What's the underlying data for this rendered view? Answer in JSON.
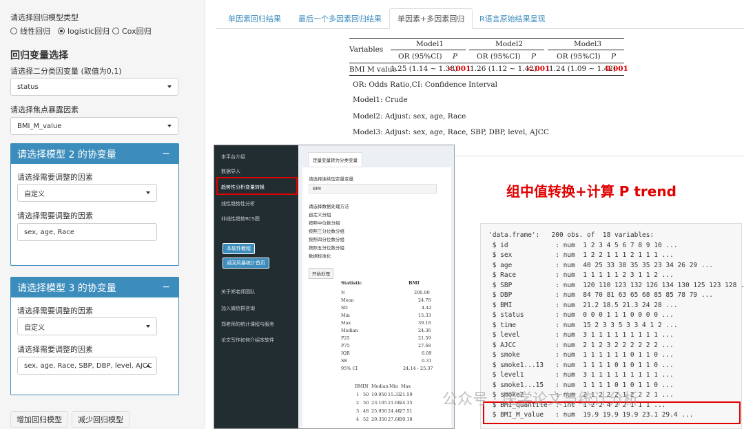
{
  "sidebar": {
    "model_type_label": "请选择回归模型类型",
    "radios": [
      "线性回归",
      "logistic回归",
      "Cox回归"
    ],
    "section_title": "回归变量选择",
    "binary_var_label": "请选择二分类因变量 (取值为0,1)",
    "binary_var_value": "status",
    "exposure_label": "请选择焦点暴露因素",
    "exposure_value": "BMI_M_value",
    "box2_title": "请选择模型 2 的协变量",
    "box2_factor_label1": "请选择需要调整的因素",
    "box2_factor_value1": "自定义",
    "box2_factor_label2": "请选择需要调整的因素",
    "box2_factor_value2": "sex, age, Race",
    "box3_title": "请选择模型 3 的协变量",
    "box3_factor_label1": "请选择需要调整的因素",
    "box3_factor_value1": "自定义",
    "box3_factor_label2": "请选择需要调整的因素",
    "box3_factor_value2": "sex, age, Race, SBP, DBP, level, AJCC",
    "minus": "−",
    "add_button": "增加回归模型",
    "remove_button": "减少回归模型"
  },
  "tabs": [
    "单因素回归结果",
    "最后一个多因素回归结果",
    "单因素+多因素回归",
    "R语言原始结果呈现"
  ],
  "table": {
    "variables": "Variables",
    "models": [
      "Model1",
      "Model2",
      "Model3"
    ],
    "or": "OR (95%CI)",
    "p": "P",
    "row_label": "BMI M value",
    "row": [
      [
        "1.25 (1.14 ~ 1.38)",
        "<.001"
      ],
      [
        "1.26 (1.12 ~ 1.42)",
        "<.001"
      ],
      [
        "1.24 (1.09 ~ 1.42)",
        "0.001"
      ]
    ]
  },
  "notes": [
    "OR: Odds Ratio,CI: Confidence Interval",
    "Model1: Crude",
    "Model2: Adjust: sex, age, Race",
    "Model3: Adjust: sex, age, Race, SBP, DBP, level, AJCC"
  ],
  "embed": {
    "menu": [
      "本平台介绍",
      "数据导入",
      "趋势性分析变量转换",
      "线性趋势性分析",
      "非线性趋势RCS图"
    ],
    "btn1": "本软件教程",
    "btn2": "返回风暴统计首页",
    "links": [
      "关于郑老师团队",
      "加入微信群咨询",
      "郑老师的统计课程与服务",
      "论文写作如何介绍本软件"
    ],
    "tab": "定量变量转为分类变量",
    "var_label": "请选择连续型定量变量",
    "var_value": "BMI",
    "method_label": "请选择数据处理方法",
    "methods": [
      "自定义分组",
      "按照中位数分组",
      "按照三分位数分组",
      "按照四分位数分组",
      "按照五分位数分组",
      "数据标准化"
    ],
    "start": "开始处理",
    "stat_head": [
      "Statistic",
      "BMI"
    ],
    "stats": [
      [
        "N",
        "200.00"
      ],
      [
        "Mean",
        "24.76"
      ],
      [
        "SD",
        "4.42"
      ],
      [
        "Min",
        "15.33"
      ],
      [
        "Max",
        "39.18"
      ],
      [
        "Median",
        "24.36"
      ],
      [
        "P25",
        "21.59"
      ],
      [
        "P75",
        "27.68"
      ],
      [
        "IQR",
        "6.09"
      ],
      [
        "SE",
        "0.31"
      ],
      [
        "95% CI",
        "24.14 - 25.37"
      ]
    ],
    "q_head": [
      "BMI",
      "N",
      "Median",
      "Min",
      "Max"
    ],
    "q_rows": [
      [
        "1",
        "50",
        "19.950",
        "15.33",
        "21.59"
      ],
      [
        "2",
        "50",
        "23.105",
        "21.60",
        "24.35"
      ],
      [
        "3",
        "48",
        "25.950",
        "24.40",
        "27.51"
      ],
      [
        "4",
        "52",
        "29.350",
        "27.68",
        "39.18"
      ]
    ]
  },
  "trend_title": "组中值转换+计算 P trend",
  "console": [
    "'data.frame':   200 obs. of  18 variables:",
    " $ id            : num  1 2 3 4 5 6 7 8 9 10 ...",
    " $ sex           : num  1 2 2 1 1 1 2 1 1 1 ...",
    " $ age           : num  40 25 33 38 35 35 23 34 26 29 ...",
    " $ Race          : num  1 1 1 1 1 2 3 1 1 2 ...",
    " $ SBP           : num  120 110 123 132 126 134 130 125 123 128 ...",
    " $ DBP           : num  84 70 81 63 65 68 85 85 78 79 ...",
    " $ BMI           : num  21.2 18.5 21.3 24 28 ...",
    " $ status        : num  0 0 0 1 1 1 0 0 0 0 ...",
    " $ time          : num  15 2 3 3 5 3 3 4 1 2 ...",
    " $ level         : num  3 1 1 1 1 1 1 1 1 1 ...",
    " $ AJCC          : num  2 1 2 3 2 2 2 2 2 2 ...",
    " $ smoke         : num  1 1 1 1 1 1 0 1 1 0 ...",
    " $ smoke1...13   : num  1 1 1 1 0 1 0 1 1 0 ...",
    " $ level1        : num  3 1 1 1 1 1 1 1 1 1 ...",
    " $ smoke1...15   : num  1 1 1 1 0 1 0 1 1 0 ...",
    " $ smoke2        : num  2 1 2 2 2 1 2 2 2 1 ...",
    " $ BMI_quantile  : int  1 2 2 4 2 2 1 1 1 ...",
    " $ BMI_M_value   : num  19.9 19.9 19.9 23.1 29.4 ..."
  ],
  "watermark": "公众号 · 医学论文与统计分析"
}
